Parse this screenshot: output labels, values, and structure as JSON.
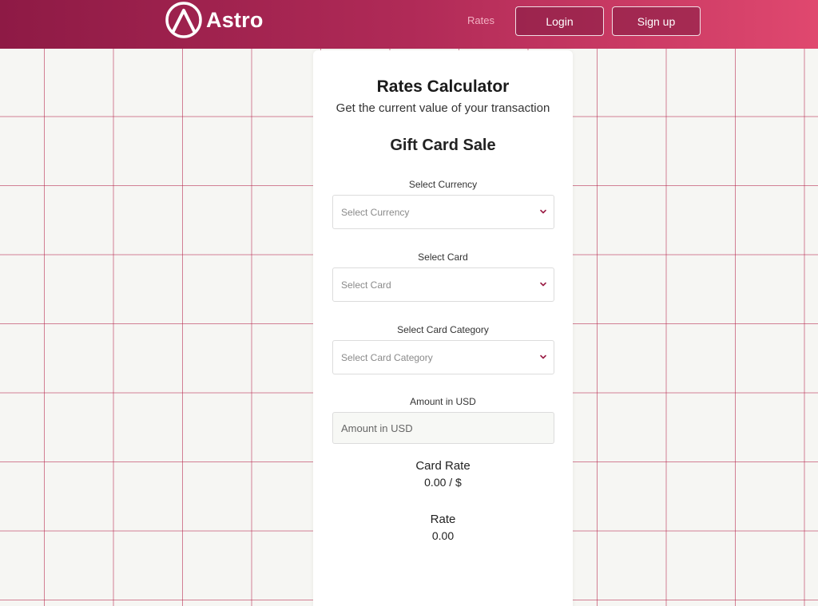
{
  "brand": {
    "name": "Astro"
  },
  "nav": {
    "rates_link": "Rates",
    "login_label": "Login",
    "signup_label": "Sign up"
  },
  "calculator": {
    "title": "Rates Calculator",
    "subtitle": "Get the current value of your transaction",
    "section_title": "Gift Card Sale",
    "currency": {
      "label": "Select Currency",
      "placeholder": "Select Currency"
    },
    "card": {
      "label": "Select Card",
      "placeholder": "Select Card"
    },
    "category": {
      "label": "Select Card Category",
      "placeholder": "Select Card Category"
    },
    "amount": {
      "label": "Amount in USD",
      "placeholder": "Amount in USD"
    },
    "card_rate": {
      "label": "Card Rate",
      "value": "0.00 / $"
    },
    "rate": {
      "label": "Rate",
      "value": "0.00"
    }
  },
  "colors": {
    "header_start": "#8e1a45",
    "header_end": "#e0486f",
    "grid_line": "#b41e46",
    "chevron": "#9b1d45"
  },
  "icons": {
    "logo": "astro-logo-icon",
    "dropdown": "chevron-down-icon"
  }
}
